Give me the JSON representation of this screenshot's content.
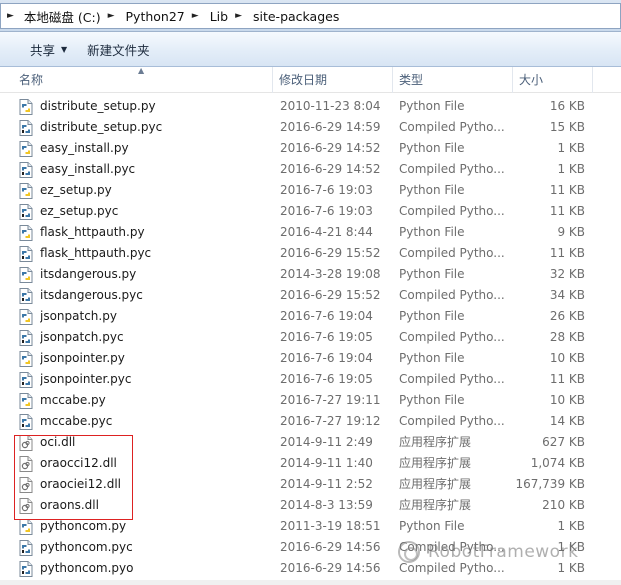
{
  "address": {
    "crumbs": [
      "本地磁盘 (C:)",
      "Python27",
      "Lib",
      "site-packages"
    ]
  },
  "toolbar": {
    "share_label": "共享",
    "new_folder_label": "新建文件夹"
  },
  "columns": {
    "name": "名称",
    "date": "修改日期",
    "type": "类型",
    "size": "大小"
  },
  "files": [
    {
      "name": "distribute_setup.py",
      "date": "2010-11-23 8:04",
      "type": "Python File",
      "size": "16 KB",
      "icon": "python-file-icon"
    },
    {
      "name": "distribute_setup.pyc",
      "date": "2016-6-29 14:59",
      "type": "Compiled Pytho...",
      "size": "15 KB",
      "icon": "compiled-python-icon"
    },
    {
      "name": "easy_install.py",
      "date": "2016-6-29 14:52",
      "type": "Python File",
      "size": "1 KB",
      "icon": "python-file-icon"
    },
    {
      "name": "easy_install.pyc",
      "date": "2016-6-29 14:52",
      "type": "Compiled Pytho...",
      "size": "1 KB",
      "icon": "compiled-python-icon"
    },
    {
      "name": "ez_setup.py",
      "date": "2016-7-6 19:03",
      "type": "Python File",
      "size": "11 KB",
      "icon": "python-file-icon"
    },
    {
      "name": "ez_setup.pyc",
      "date": "2016-7-6 19:03",
      "type": "Compiled Pytho...",
      "size": "11 KB",
      "icon": "compiled-python-icon"
    },
    {
      "name": "flask_httpauth.py",
      "date": "2016-4-21 8:44",
      "type": "Python File",
      "size": "9 KB",
      "icon": "python-file-icon"
    },
    {
      "name": "flask_httpauth.pyc",
      "date": "2016-6-29 15:52",
      "type": "Compiled Pytho...",
      "size": "11 KB",
      "icon": "compiled-python-icon"
    },
    {
      "name": "itsdangerous.py",
      "date": "2014-3-28 19:08",
      "type": "Python File",
      "size": "32 KB",
      "icon": "python-file-icon"
    },
    {
      "name": "itsdangerous.pyc",
      "date": "2016-6-29 15:52",
      "type": "Compiled Pytho...",
      "size": "34 KB",
      "icon": "compiled-python-icon"
    },
    {
      "name": "jsonpatch.py",
      "date": "2016-7-6 19:04",
      "type": "Python File",
      "size": "26 KB",
      "icon": "python-file-icon"
    },
    {
      "name": "jsonpatch.pyc",
      "date": "2016-7-6 19:05",
      "type": "Compiled Pytho...",
      "size": "28 KB",
      "icon": "compiled-python-icon"
    },
    {
      "name": "jsonpointer.py",
      "date": "2016-7-6 19:04",
      "type": "Python File",
      "size": "10 KB",
      "icon": "python-file-icon"
    },
    {
      "name": "jsonpointer.pyc",
      "date": "2016-7-6 19:05",
      "type": "Compiled Pytho...",
      "size": "11 KB",
      "icon": "compiled-python-icon"
    },
    {
      "name": "mccabe.py",
      "date": "2016-7-27 19:11",
      "type": "Python File",
      "size": "10 KB",
      "icon": "python-file-icon"
    },
    {
      "name": "mccabe.pyc",
      "date": "2016-7-27 19:12",
      "type": "Compiled Pytho...",
      "size": "14 KB",
      "icon": "compiled-python-icon"
    },
    {
      "name": "oci.dll",
      "date": "2014-9-11 2:49",
      "type": "应用程序扩展",
      "size": "627 KB",
      "icon": "dll-file-icon"
    },
    {
      "name": "oraocci12.dll",
      "date": "2014-9-11 1:40",
      "type": "应用程序扩展",
      "size": "1,074 KB",
      "icon": "dll-file-icon"
    },
    {
      "name": "oraociei12.dll",
      "date": "2014-9-11 2:52",
      "type": "应用程序扩展",
      "size": "167,739 KB",
      "icon": "dll-file-icon"
    },
    {
      "name": "oraons.dll",
      "date": "2014-8-3 13:59",
      "type": "应用程序扩展",
      "size": "210 KB",
      "icon": "dll-file-icon"
    },
    {
      "name": "pythoncom.py",
      "date": "2011-3-19 18:51",
      "type": "Python File",
      "size": "1 KB",
      "icon": "python-file-icon"
    },
    {
      "name": "pythoncom.pyc",
      "date": "2016-6-29 14:56",
      "type": "Compiled Pytho...",
      "size": "1 KB",
      "icon": "compiled-python-icon"
    },
    {
      "name": "pythoncom.pyo",
      "date": "2016-6-29 14:56",
      "type": "Compiled Pytho...",
      "size": "1 KB",
      "icon": "compiled-python-icon"
    }
  ],
  "watermark": "RobotFramework",
  "colors": {
    "highlight_box": "#d22222",
    "toolbar_top": "#f5f9fe",
    "toolbar_bottom": "#d8e5f4"
  }
}
